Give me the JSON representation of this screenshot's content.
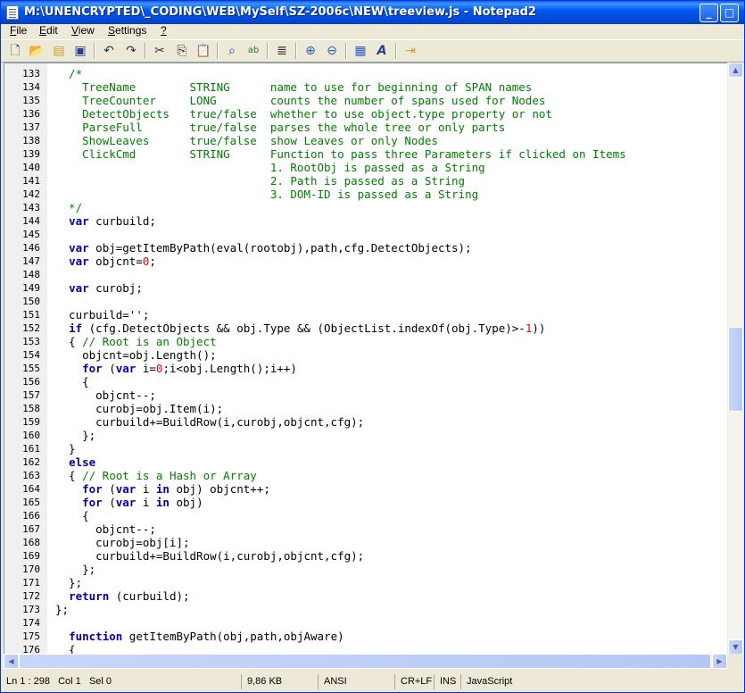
{
  "window": {
    "title": "M:\\UNENCRYPTED\\_CODING\\WEB\\MySelf\\SZ-2006c\\NEW\\treeview.js - Notepad2",
    "minimize": "_",
    "maximize": "□",
    "close": "×"
  },
  "menu": [
    {
      "u": "F",
      "rest": "ile"
    },
    {
      "u": "E",
      "rest": "dit"
    },
    {
      "u": "V",
      "rest": "iew"
    },
    {
      "u": "S",
      "rest": "ettings"
    },
    {
      "u": "?",
      "rest": ""
    }
  ],
  "toolbar_icons": [
    "new-file-icon",
    "open-file-icon",
    "browse-icon",
    "save-icon",
    "undo-icon",
    "redo-icon",
    "cut-icon",
    "copy-icon",
    "paste-icon",
    "find-icon",
    "replace-icon",
    "word-wrap-icon",
    "zoom-in-icon",
    "zoom-out-icon",
    "schemes-icon",
    "font-icon",
    "exit-icon"
  ],
  "editor": {
    "lines": [
      {
        "n": "133",
        "code": [
          [
            "c",
            "  /*"
          ]
        ]
      },
      {
        "n": "134",
        "code": [
          [
            "c",
            "    TreeName        STRING      name to use for beginning of SPAN names"
          ]
        ]
      },
      {
        "n": "135",
        "code": [
          [
            "c",
            "    TreeCounter     LONG        counts the number of spans used for Nodes"
          ]
        ]
      },
      {
        "n": "136",
        "code": [
          [
            "c",
            "    DetectObjects   true/false  whether to use object.type property or not"
          ]
        ]
      },
      {
        "n": "137",
        "code": [
          [
            "c",
            "    ParseFull       true/false  parses the whole tree or only parts"
          ]
        ]
      },
      {
        "n": "138",
        "code": [
          [
            "c",
            "    ShowLeaves      true/false  show Leaves or only Nodes"
          ]
        ]
      },
      {
        "n": "139",
        "code": [
          [
            "c",
            "    ClickCmd        STRING      Function to pass three Parameters if clicked on Items"
          ]
        ]
      },
      {
        "n": "140",
        "code": [
          [
            "c",
            "                                1. RootObj is passed as a String"
          ]
        ]
      },
      {
        "n": "141",
        "code": [
          [
            "c",
            "                                2. Path is passed as a String"
          ]
        ]
      },
      {
        "n": "142",
        "code": [
          [
            "c",
            "                                3. DOM-ID is passed as a String"
          ]
        ]
      },
      {
        "n": "143",
        "code": [
          [
            "c",
            "  */"
          ]
        ]
      },
      {
        "n": "144",
        "code": [
          [
            "t",
            "  "
          ],
          [
            "k",
            "var"
          ],
          [
            "t",
            " curbuild;"
          ]
        ]
      },
      {
        "n": "145",
        "code": []
      },
      {
        "n": "146",
        "code": [
          [
            "t",
            "  "
          ],
          [
            "k",
            "var"
          ],
          [
            "t",
            " obj=getItemByPath(eval(rootobj),path,cfg.DetectObjects);"
          ]
        ]
      },
      {
        "n": "147",
        "code": [
          [
            "t",
            "  "
          ],
          [
            "k",
            "var"
          ],
          [
            "t",
            " objcnt="
          ],
          [
            "n",
            "0"
          ],
          [
            "t",
            ";"
          ]
        ]
      },
      {
        "n": "148",
        "code": []
      },
      {
        "n": "149",
        "code": [
          [
            "t",
            "  "
          ],
          [
            "k",
            "var"
          ],
          [
            "t",
            " curobj;"
          ]
        ]
      },
      {
        "n": "150",
        "code": []
      },
      {
        "n": "151",
        "code": [
          [
            "t",
            "  curbuild="
          ],
          [
            "s",
            "''"
          ],
          [
            "t",
            ";"
          ]
        ]
      },
      {
        "n": "152",
        "code": [
          [
            "t",
            "  "
          ],
          [
            "k",
            "if"
          ],
          [
            "t",
            " (cfg.DetectObjects && obj.Type && (ObjectList.indexOf(obj.Type)>-"
          ],
          [
            "n",
            "1"
          ],
          [
            "t",
            "))"
          ]
        ]
      },
      {
        "n": "153",
        "code": [
          [
            "t",
            "  { "
          ],
          [
            "c",
            "// Root is an Object"
          ]
        ]
      },
      {
        "n": "154",
        "code": [
          [
            "t",
            "    objcnt=obj.Length();"
          ]
        ]
      },
      {
        "n": "155",
        "code": [
          [
            "t",
            "    "
          ],
          [
            "k",
            "for"
          ],
          [
            "t",
            " ("
          ],
          [
            "k",
            "var"
          ],
          [
            "t",
            " i="
          ],
          [
            "n",
            "0"
          ],
          [
            "t",
            ";i<obj.Length();i++)"
          ]
        ]
      },
      {
        "n": "156",
        "code": [
          [
            "t",
            "    {"
          ]
        ]
      },
      {
        "n": "157",
        "code": [
          [
            "t",
            "      objcnt--;"
          ]
        ]
      },
      {
        "n": "158",
        "code": [
          [
            "t",
            "      curobj=obj.Item(i);"
          ]
        ]
      },
      {
        "n": "159",
        "code": [
          [
            "t",
            "      curbuild+=BuildRow(i,curobj,objcnt,cfg);"
          ]
        ]
      },
      {
        "n": "160",
        "code": [
          [
            "t",
            "    };"
          ]
        ]
      },
      {
        "n": "161",
        "code": [
          [
            "t",
            "  }"
          ]
        ]
      },
      {
        "n": "162",
        "code": [
          [
            "t",
            "  "
          ],
          [
            "k",
            "else"
          ]
        ]
      },
      {
        "n": "163",
        "code": [
          [
            "t",
            "  { "
          ],
          [
            "c",
            "// Root is a Hash or Array"
          ]
        ]
      },
      {
        "n": "164",
        "code": [
          [
            "t",
            "    "
          ],
          [
            "k",
            "for"
          ],
          [
            "t",
            " ("
          ],
          [
            "k",
            "var"
          ],
          [
            "t",
            " i "
          ],
          [
            "k",
            "in"
          ],
          [
            "t",
            " obj) objcnt++;"
          ]
        ]
      },
      {
        "n": "165",
        "code": [
          [
            "t",
            "    "
          ],
          [
            "k",
            "for"
          ],
          [
            "t",
            " ("
          ],
          [
            "k",
            "var"
          ],
          [
            "t",
            " i "
          ],
          [
            "k",
            "in"
          ],
          [
            "t",
            " obj)"
          ]
        ]
      },
      {
        "n": "166",
        "code": [
          [
            "t",
            "    {"
          ]
        ]
      },
      {
        "n": "167",
        "code": [
          [
            "t",
            "      objcnt--;"
          ]
        ]
      },
      {
        "n": "168",
        "code": [
          [
            "t",
            "      curobj=obj[i];"
          ]
        ]
      },
      {
        "n": "169",
        "code": [
          [
            "t",
            "      curbuild+=BuildRow(i,curobj,objcnt,cfg);"
          ]
        ]
      },
      {
        "n": "170",
        "code": [
          [
            "t",
            "    };"
          ]
        ]
      },
      {
        "n": "171",
        "code": [
          [
            "t",
            "  };"
          ]
        ]
      },
      {
        "n": "172",
        "code": [
          [
            "t",
            "  "
          ],
          [
            "k",
            "return"
          ],
          [
            "t",
            " (curbuild);"
          ]
        ]
      },
      {
        "n": "173",
        "code": [
          [
            "t",
            "};"
          ]
        ]
      },
      {
        "n": "174",
        "code": []
      },
      {
        "n": "175",
        "code": [
          [
            "t",
            "  "
          ],
          [
            "k",
            "function"
          ],
          [
            "t",
            " getItemByPath(obj,path,objAware)"
          ]
        ]
      },
      {
        "n": "176",
        "code": [
          [
            "t",
            "  {"
          ]
        ]
      }
    ]
  },
  "status": {
    "position": "Ln 1 : 298",
    "col": "Col 1",
    "sel": "Sel 0",
    "size": "9,86 KB",
    "encoding": "ANSI",
    "line_endings": "CR+LF",
    "mode": "INS",
    "lexer": "JavaScript"
  },
  "colors": {
    "comment": "#008000",
    "keyword": "#0000aa",
    "number": "#ff0000",
    "titlebar": "#0058ee"
  }
}
